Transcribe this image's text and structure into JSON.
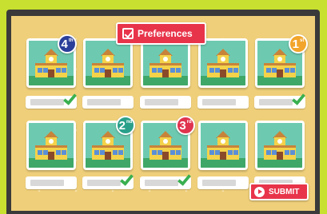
{
  "header": {
    "preferences_label": "Preferences",
    "preferences_icon": "checkbox-icon"
  },
  "cards": [
    {
      "id": "r1c1",
      "icon": "school-building",
      "checked": true,
      "rank": "4",
      "rank_suffix": "th",
      "rank_color": "#2a3f9a"
    },
    {
      "id": "r1c2",
      "icon": "school-building",
      "checked": false,
      "rank": "",
      "rank_suffix": "",
      "rank_color": ""
    },
    {
      "id": "r1c3",
      "icon": "school-building",
      "checked": false,
      "rank": "",
      "rank_suffix": "",
      "rank_color": ""
    },
    {
      "id": "r1c4",
      "icon": "school-building",
      "checked": false,
      "rank": "",
      "rank_suffix": "",
      "rank_color": ""
    },
    {
      "id": "r1c5",
      "icon": "school-building",
      "checked": true,
      "rank": "1",
      "rank_suffix": "st",
      "rank_color": "#f2a52a"
    },
    {
      "id": "r2c1",
      "icon": "school-building",
      "checked": false,
      "rank": "",
      "rank_suffix": "",
      "rank_color": ""
    },
    {
      "id": "r2c2",
      "icon": "school-building",
      "checked": true,
      "rank": "2",
      "rank_suffix": "nd",
      "rank_color": "#2aa08a"
    },
    {
      "id": "r2c3",
      "icon": "school-building",
      "checked": true,
      "rank": "3",
      "rank_suffix": "rd",
      "rank_color": "#e0344e"
    },
    {
      "id": "r2c4",
      "icon": "school-building",
      "checked": false,
      "rank": "",
      "rank_suffix": "",
      "rank_color": ""
    },
    {
      "id": "r2c5",
      "icon": "school-building",
      "checked": false,
      "rank": "",
      "rank_suffix": "",
      "rank_color": ""
    }
  ],
  "footer": {
    "submit_label": "SUBMIT",
    "submit_icon": "play-icon"
  },
  "colors": {
    "accent": "#e8344a",
    "board": "#efcf7a",
    "frame": "#c8e030",
    "check": "#3ab050"
  }
}
